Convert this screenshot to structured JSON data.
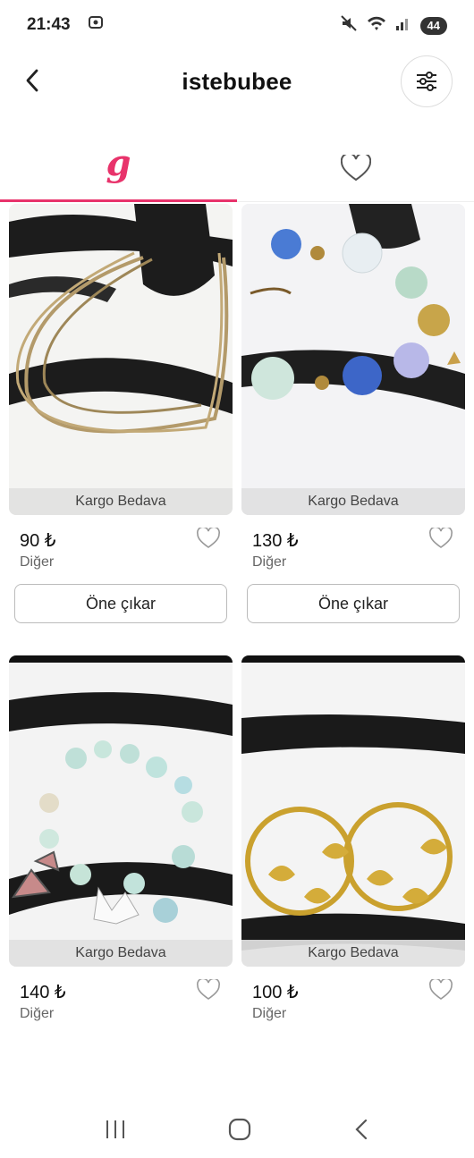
{
  "status": {
    "time": "21:43",
    "battery": "44"
  },
  "header": {
    "title": "istebubee"
  },
  "tabs": [
    {
      "name": "closet",
      "icon": "g-logo-icon",
      "glyph": "g",
      "active": true
    },
    {
      "name": "favorites",
      "icon": "heart-outline-icon",
      "active": false
    }
  ],
  "products": [
    {
      "ribbon": "Kargo Bedava",
      "price": "90 ₺",
      "category": "Diğer",
      "promote_label": "Öne çıkar"
    },
    {
      "ribbon": "Kargo Bedava",
      "price": "130 ₺",
      "category": "Diğer",
      "promote_label": "Öne çıkar"
    },
    {
      "ribbon": "Kargo Bedava",
      "price": "140 ₺",
      "category": "Diğer"
    },
    {
      "ribbon": "Kargo Bedava",
      "price": "100 ₺",
      "category": "Diğer"
    }
  ],
  "colors": {
    "accent": "#e8336b",
    "ribbon_bg": "#e1e1e1"
  }
}
